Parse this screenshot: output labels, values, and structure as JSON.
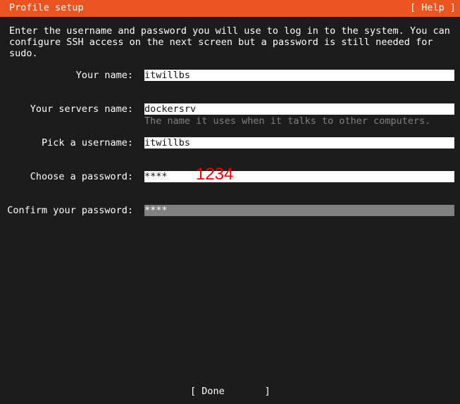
{
  "header": {
    "title": "Profile setup",
    "help_label": "[ Help ]",
    "background_color": "#e95420"
  },
  "intro_text": "Enter the username and password you will use to log in to the system. You can configure SSH access on the next screen but a password is still needed for sudo.",
  "form": {
    "your_name": {
      "label": "Your name:",
      "value": "itwillbs"
    },
    "server_name": {
      "label": "Your servers name:",
      "value": "dockersrv",
      "hint": "The name it uses when it talks to other computers."
    },
    "username": {
      "label": "Pick a username:",
      "value": "itwillbs"
    },
    "password": {
      "label": "Choose a password:",
      "value": "****"
    },
    "confirm_password": {
      "label": "Confirm your password:",
      "value": "****"
    }
  },
  "annotation": {
    "text": "1234",
    "color": "#ee0000"
  },
  "footer": {
    "done_open": "[ ",
    "done_label": "Done",
    "done_close": "       ]"
  }
}
